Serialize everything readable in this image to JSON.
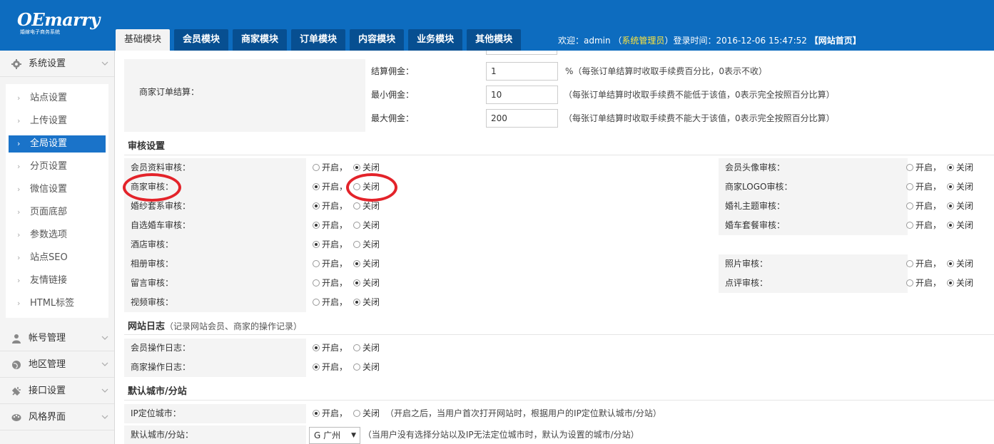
{
  "header": {
    "logo_main": "OEmarry",
    "logo_sub": "婚嫁电子商务系统",
    "tabs": [
      "基础模块",
      "会员模块",
      "商家模块",
      "订单模块",
      "内容模块",
      "业务模块",
      "其他模块"
    ],
    "active_tab": 0,
    "welcome_prefix": "欢迎：admin （",
    "role": "系统管理员",
    "welcome_suffix": "）登录时间：2016-12-06 15:47:52",
    "home_link": "【网站首页】"
  },
  "sidebar": {
    "sections": [
      {
        "label": "系统设置",
        "icon": "gear-icon"
      },
      {
        "label": "帐号管理",
        "icon": "user-icon"
      },
      {
        "label": "地区管理",
        "icon": "globe-icon"
      },
      {
        "label": "接口设置",
        "icon": "plug-icon"
      },
      {
        "label": "风格界面",
        "icon": "palette-icon"
      }
    ],
    "items": [
      {
        "label": "站点设置"
      },
      {
        "label": "上传设置"
      },
      {
        "label": "全局设置",
        "active": true
      },
      {
        "label": "分页设置"
      },
      {
        "label": "微信设置"
      },
      {
        "label": "页面底部"
      },
      {
        "label": "参数选项"
      },
      {
        "label": "站点SEO"
      },
      {
        "label": "友情链接"
      },
      {
        "label": "HTML标签"
      }
    ]
  },
  "settlement": {
    "label": "商家订单结算：",
    "rows": [
      {
        "label": "结算佣金：",
        "value": "1",
        "hint": "%（每张订单结算时收取手续费百分比，0表示不收）"
      },
      {
        "label": "最小佣金：",
        "value": "10",
        "hint": "（每张订单结算时收取手续费不能低于该值，0表示完全按照百分比算）"
      },
      {
        "label": "最大佣金：",
        "value": "200",
        "hint": "（每张订单结算时收取手续费不能大于该值，0表示完全按照百分比算）"
      }
    ]
  },
  "audit": {
    "title": "审核设置",
    "on_label": "开启，",
    "off_label": "关闭",
    "left": [
      {
        "label": "会员资料审核：",
        "on": false
      },
      {
        "label": "商家审核：",
        "on": true
      },
      {
        "label": "婚纱套系审核：",
        "on": true
      },
      {
        "label": "自选婚车审核：",
        "on": true
      },
      {
        "label": "酒店审核：",
        "on": true
      },
      {
        "label": "相册审核：",
        "on": false
      },
      {
        "label": "留言审核：",
        "on": false
      },
      {
        "label": "视频审核：",
        "on": false
      }
    ],
    "right": [
      {
        "label": "会员头像审核：",
        "on": false
      },
      {
        "label": "商家LOGO审核：",
        "on": false
      },
      {
        "label": "婚礼主题审核：",
        "on": false
      },
      {
        "label": "婚车套餐审核：",
        "on": false
      },
      null,
      {
        "label": "照片审核：",
        "on": false
      },
      {
        "label": "点评审核：",
        "on": false
      },
      null
    ]
  },
  "logs": {
    "title": "网站日志",
    "note": "（记录网站会员、商家的操作记录）",
    "rows": [
      {
        "label": "会员操作日志：",
        "on": true
      },
      {
        "label": "商家操作日志：",
        "on": true
      }
    ]
  },
  "city": {
    "title": "默认城市/分站",
    "ip_label": "IP定位城市：",
    "ip_on": true,
    "ip_hint": "（开启之后，当用户首次打开网站时，根据用户的IP定位默认城市/分站）",
    "default_label": "默认城市/分站：",
    "default_value": "G 广州",
    "default_hint": "（当用户没有选择分站以及IP无法定位城市时，默认为设置的城市/分站）"
  },
  "colors": {
    "header_bg": "#0d6cbf",
    "tab_bg": "#074f91",
    "active_item": "#1a73c9",
    "highlight_ring": "#e3232a",
    "role_text": "#ffe53d"
  }
}
